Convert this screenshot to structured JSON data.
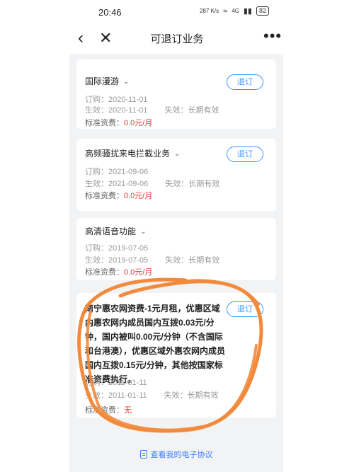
{
  "status": {
    "time": "20:46",
    "net_speed": "287 K/s",
    "signal": "4G",
    "battery": "82"
  },
  "nav": {
    "back": "‹",
    "close": "✕",
    "title": "可退订业务",
    "more": "•••"
  },
  "cards": [
    {
      "title": "国际漫游",
      "button": "退订",
      "order_label": "订购：",
      "order_date": "2020-11-01",
      "effect_label": "生效：",
      "effect_date": "2020-11-01",
      "expire_label": "失效：",
      "expire_value": "长期有效",
      "fee_label": "标准资费：",
      "fee_value": "0.0元/月"
    },
    {
      "title": "高频骚扰来电拦截业务",
      "button": "退订",
      "order_label": "订购：",
      "order_date": "2021-09-06",
      "effect_label": "生效：",
      "effect_date": "2021-09-06",
      "expire_label": "失效：",
      "expire_value": "长期有效",
      "fee_label": "标准资费：",
      "fee_value": "0.0元/月"
    },
    {
      "title": "高清语音功能",
      "button": "退订",
      "order_label": "订购：",
      "order_date": "2019-07-05",
      "effect_label": "生效：",
      "effect_date": "2019-07-05",
      "expire_label": "失效：",
      "expire_value": "长期有效",
      "fee_label": "标准资费：",
      "fee_value": "0.0元/月"
    },
    {
      "title": "南宁惠农网资费-1元月租，优惠区域内惠农网内成员国内互拨0.03元/分钟，国内被叫0.00元/分钟（不含国际和台港澳），优惠区域外惠农网内成员国内互拨0.15元/分钟，其他按国家标准资费执行。",
      "button": "退订",
      "order_label": "订购：",
      "order_date": "2011-01-11",
      "effect_label": "生效：",
      "effect_date": "2011-01-11",
      "expire_label": "失效：",
      "expire_value": "长期有效",
      "fee_label": "标准资费：",
      "fee_value": "无"
    }
  ],
  "footer": {
    "link": "查看我的电子协议"
  },
  "colors": {
    "accent": "#3b97ff",
    "fee_red": "#e23b3b",
    "annotation": "#f28a3c",
    "background": "#f2f3f5"
  }
}
